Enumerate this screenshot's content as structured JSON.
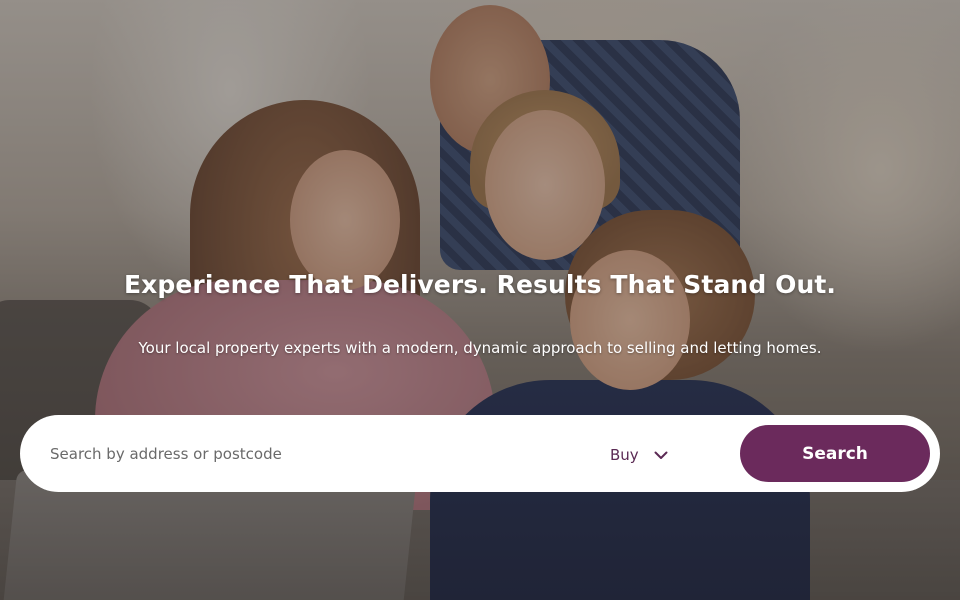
{
  "hero": {
    "headline": "Experience That Delivers. Results That Stand Out.",
    "subheadline": "Your local property experts with a modern, dynamic approach to selling and letting homes."
  },
  "search": {
    "placeholder": "Search by address or postcode",
    "value": "",
    "type_selected": "Buy",
    "button_label": "Search"
  },
  "colors": {
    "accent": "#6b2a5c",
    "select_text": "#5b2a54",
    "bar_background": "#ffffff"
  },
  "icons": {
    "dropdown": "chevron-down-icon"
  }
}
